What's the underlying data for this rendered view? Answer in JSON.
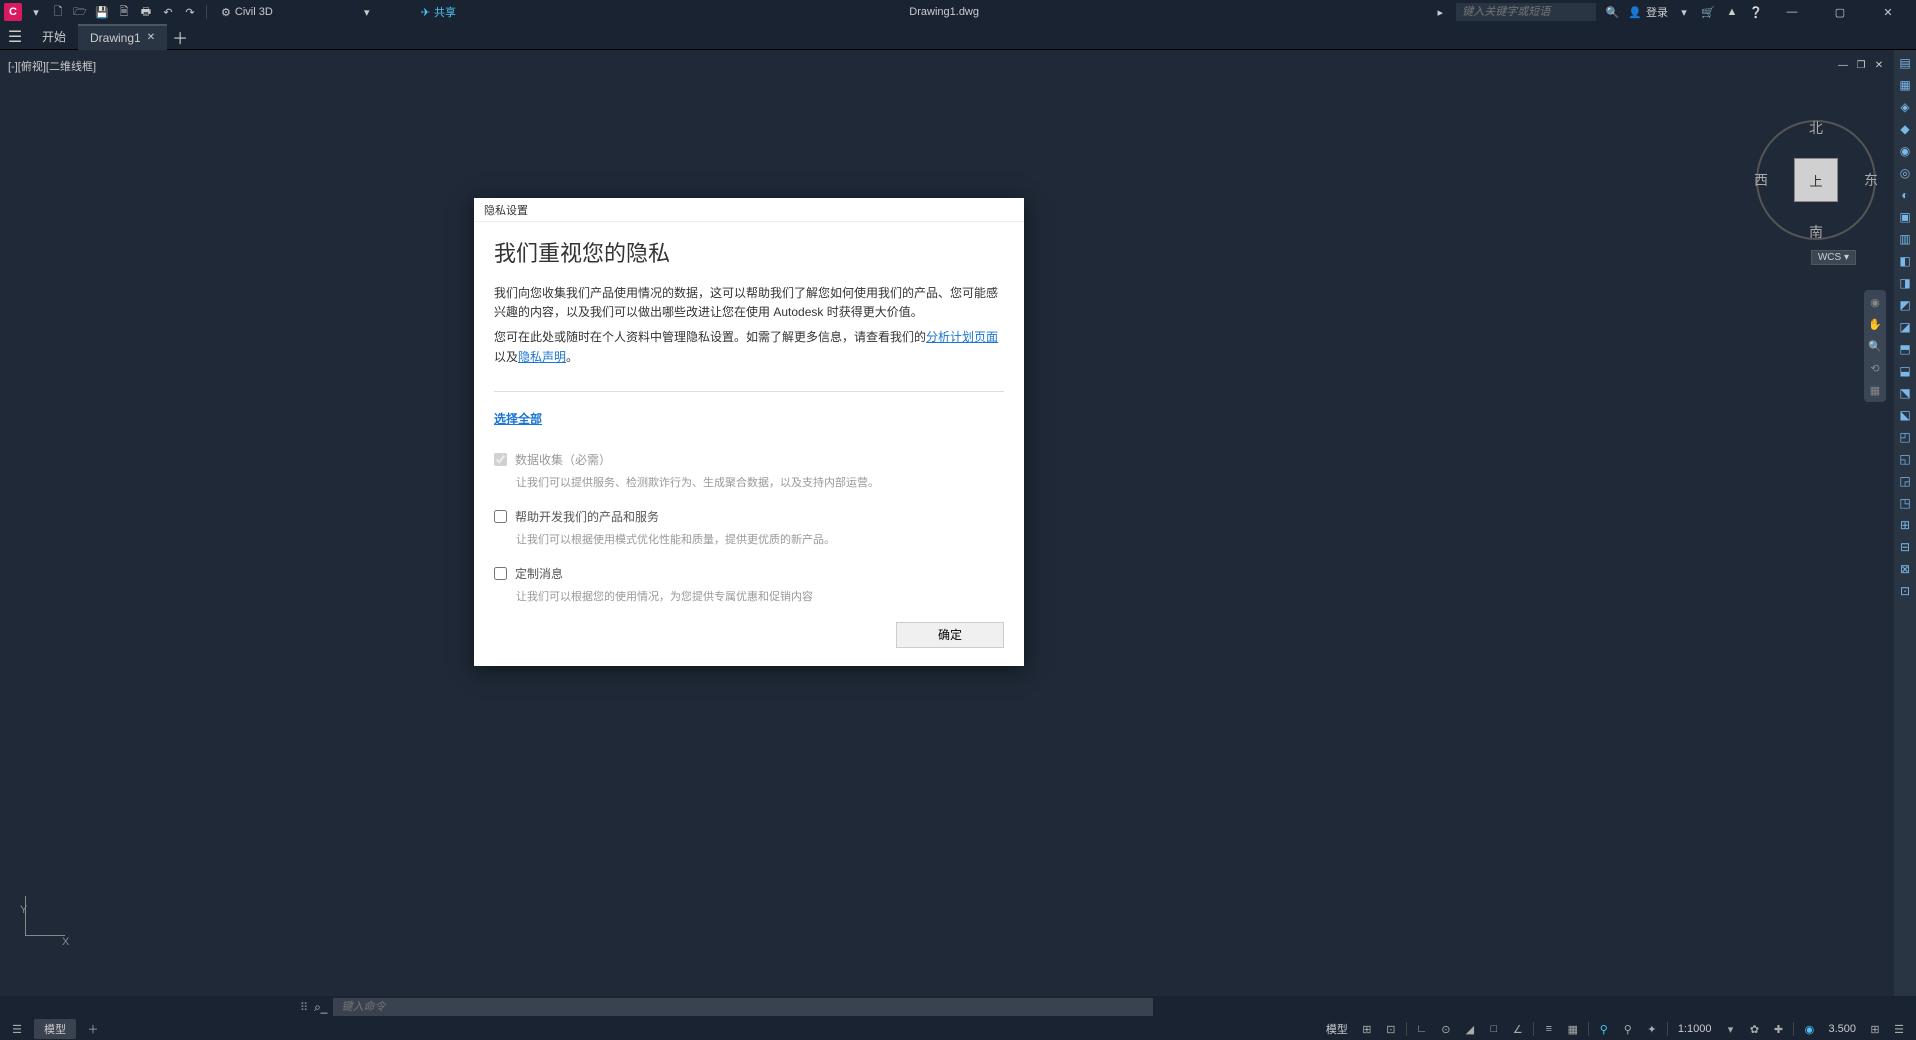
{
  "titlebar": {
    "app_letter": "C",
    "workspace": "Civil 3D",
    "share": "共享",
    "document_title": "Drawing1.dwg",
    "search_placeholder": "键入关键字或短语",
    "login": "登录"
  },
  "tabs": {
    "start": "开始",
    "drawing": "Drawing1"
  },
  "viewport": {
    "label": "[-][俯视][二维线框]"
  },
  "viewcube": {
    "n": "北",
    "s": "南",
    "e": "东",
    "w": "西",
    "top": "上",
    "wcs": "WCS"
  },
  "ucs": {
    "x": "X",
    "y": "Y"
  },
  "cmdline": {
    "placeholder": "键入命令"
  },
  "statusbar": {
    "model": "模型",
    "scale": "1:1000",
    "decimal": "3.500"
  },
  "dialog": {
    "title": "隐私设置",
    "heading": "我们重视您的隐私",
    "para1": "我们向您收集我们产品使用情况的数据，这可以帮助我们了解您如何使用我们的产品、您可能感兴趣的内容，以及我们可以做出哪些改进让您在使用 Autodesk 时获得更大价值。",
    "para2_a": "您可在此处或随时在个人资料中管理隐私设置。如需了解更多信息，请查看我们的",
    "link_analytics": "分析计划页面",
    "para2_b": "以及",
    "link_privacy": "隐私声明",
    "para2_c": "。",
    "select_all": "选择全部",
    "opt1_label": "数据收集（必需）",
    "opt1_desc": "让我们可以提供服务、检测欺诈行为、生成聚合数据，以及支持内部运营。",
    "opt2_label": "帮助开发我们的产品和服务",
    "opt2_desc": "让我们可以根据使用模式优化性能和质量，提供更优质的新产品。",
    "opt3_label": "定制消息",
    "opt3_desc": "让我们可以根据您的使用情况，为您提供专属优惠和促销内容",
    "ok": "确定"
  }
}
